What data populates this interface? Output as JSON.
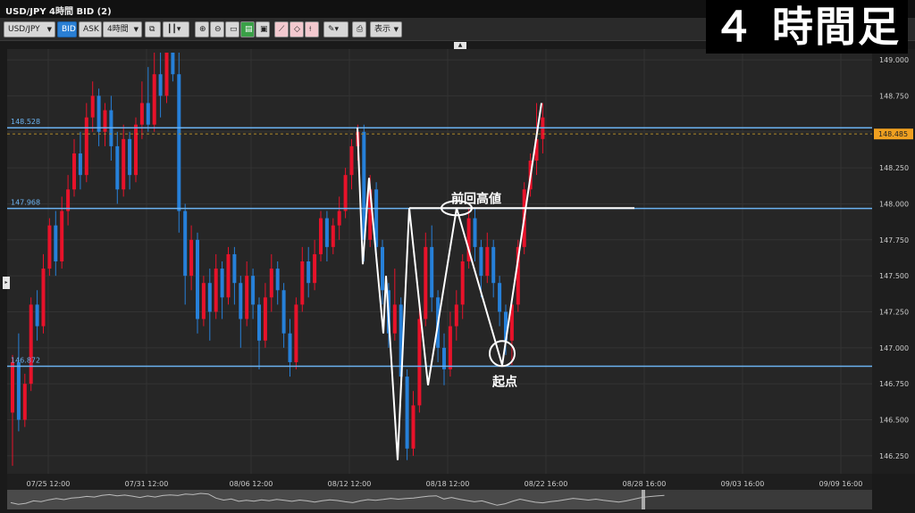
{
  "window": {
    "title": "USD/JPY 4時間 BID (2)"
  },
  "toolbar": {
    "symbol": "USD/JPY",
    "bid_label": "BID",
    "ask_label": "ASK",
    "timeframe": "4時間",
    "display_label": "表示"
  },
  "overlay": {
    "title": "４ 時間足"
  },
  "annotations": {
    "prev_high": "前回高値",
    "start_point": "起点"
  },
  "colors": {
    "up": "#e8122a",
    "down": "#2680d9",
    "hline": "#6bb2f0",
    "background": "#262626"
  },
  "chart_data": {
    "type": "candlestick",
    "y_ticks": [
      "149.000",
      "148.750",
      "148.500",
      "148.250",
      "148.000",
      "147.750",
      "147.500",
      "147.250",
      "147.000",
      "146.750",
      "146.500",
      "146.250"
    ],
    "x_ticks": [
      "07/25 12:00",
      "07/31 12:00",
      "08/06 12:00",
      "08/12 12:00",
      "08/18 12:00",
      "08/22 16:00",
      "08/28 16:00",
      "09/03 16:00",
      "09/09 16:00"
    ],
    "ylim": [
      146.15,
      149.05
    ],
    "current_price": "148.485",
    "current_price_value": 148.485,
    "horizontal_lines": [
      {
        "label": "148.528",
        "value": 148.528
      },
      {
        "label": "147.968",
        "value": 147.968
      },
      {
        "label": "146.872",
        "value": 146.872
      }
    ],
    "zigzag_prices": [
      148.53,
      147.58,
      148.18,
      147.1,
      147.5,
      146.22,
      147.97,
      146.74,
      147.97,
      146.88,
      148.7
    ],
    "prev_high_level": 147.97,
    "start_point_price": 146.96,
    "prev_high_marker_price": 147.97,
    "candles": [
      [
        146.55,
        146.9,
        146.18,
        146.95
      ],
      [
        146.9,
        146.5,
        146.42,
        147.1
      ],
      [
        146.5,
        146.75,
        146.45,
        146.82
      ],
      [
        146.75,
        147.3,
        146.7,
        147.35
      ],
      [
        147.3,
        147.15,
        147.05,
        147.4
      ],
      [
        147.15,
        147.55,
        147.1,
        147.65
      ],
      [
        147.55,
        147.85,
        147.5,
        147.9
      ],
      [
        147.85,
        147.6,
        147.5,
        147.95
      ],
      [
        147.6,
        147.95,
        147.55,
        148.05
      ],
      [
        147.95,
        148.1,
        147.85,
        148.2
      ],
      [
        148.1,
        148.35,
        148.05,
        148.45
      ],
      [
        148.35,
        148.2,
        148.1,
        148.5
      ],
      [
        148.2,
        148.6,
        148.15,
        148.7
      ],
      [
        148.6,
        148.75,
        148.5,
        148.85
      ],
      [
        148.75,
        148.5,
        148.4,
        148.8
      ],
      [
        148.5,
        148.65,
        148.4,
        148.7
      ],
      [
        148.65,
        148.4,
        148.3,
        148.75
      ],
      [
        148.4,
        148.1,
        148.0,
        148.5
      ],
      [
        148.1,
        148.45,
        148.05,
        148.55
      ],
      [
        148.45,
        148.2,
        148.1,
        148.5
      ],
      [
        148.2,
        148.55,
        148.15,
        148.6
      ],
      [
        148.55,
        148.7,
        148.45,
        148.85
      ],
      [
        148.7,
        148.55,
        148.5,
        148.95
      ],
      [
        148.55,
        148.9,
        148.5,
        149.05
      ],
      [
        148.9,
        148.75,
        148.6,
        149.05
      ],
      [
        148.75,
        149.05,
        148.7,
        149.05
      ],
      [
        149.05,
        148.9,
        148.85,
        149.05
      ],
      [
        148.9,
        147.95,
        147.8,
        149.05
      ],
      [
        147.95,
        147.5,
        147.3,
        148.0
      ],
      [
        147.5,
        147.75,
        147.4,
        147.85
      ],
      [
        147.75,
        147.2,
        147.1,
        147.8
      ],
      [
        147.2,
        147.45,
        147.15,
        147.5
      ],
      [
        147.45,
        147.25,
        147.05,
        147.55
      ],
      [
        147.25,
        147.55,
        147.2,
        147.65
      ],
      [
        147.55,
        147.35,
        147.2,
        147.6
      ],
      [
        147.35,
        147.65,
        147.3,
        147.7
      ],
      [
        147.65,
        147.45,
        147.3,
        147.7
      ],
      [
        147.45,
        147.2,
        147.0,
        147.5
      ],
      [
        147.2,
        147.5,
        147.15,
        147.6
      ],
      [
        147.5,
        147.3,
        147.2,
        147.55
      ],
      [
        147.3,
        147.05,
        146.85,
        147.35
      ],
      [
        147.05,
        147.35,
        147.0,
        147.45
      ],
      [
        147.35,
        147.55,
        147.25,
        147.65
      ],
      [
        147.55,
        147.4,
        147.3,
        147.6
      ],
      [
        147.4,
        147.1,
        147.0,
        147.45
      ],
      [
        147.1,
        146.9,
        146.8,
        147.2
      ],
      [
        146.9,
        147.3,
        146.85,
        147.35
      ],
      [
        147.3,
        147.6,
        147.25,
        147.7
      ],
      [
        147.6,
        147.45,
        147.35,
        147.7
      ],
      [
        147.45,
        147.65,
        147.4,
        147.75
      ],
      [
        147.65,
        147.9,
        147.6,
        147.95
      ],
      [
        147.9,
        147.7,
        147.6,
        147.95
      ],
      [
        147.7,
        147.85,
        147.65,
        147.9
      ],
      [
        147.85,
        147.95,
        147.75,
        148.05
      ],
      [
        147.95,
        148.2,
        147.9,
        148.25
      ],
      [
        148.2,
        148.4,
        148.1,
        148.45
      ],
      [
        148.4,
        148.5,
        148.3,
        148.55
      ],
      [
        148.5,
        147.75,
        147.6,
        148.55
      ],
      [
        147.75,
        148.1,
        147.7,
        148.2
      ],
      [
        148.1,
        147.7,
        147.6,
        148.15
      ],
      [
        147.7,
        147.4,
        147.3,
        147.75
      ],
      [
        147.4,
        147.1,
        147.0,
        147.45
      ],
      [
        147.1,
        147.3,
        147.05,
        147.55
      ],
      [
        147.3,
        146.8,
        146.7,
        147.35
      ],
      [
        146.8,
        146.3,
        146.22,
        146.85
      ],
      [
        146.3,
        146.6,
        146.25,
        146.7
      ],
      [
        146.6,
        147.2,
        146.55,
        147.3
      ],
      [
        147.2,
        147.7,
        147.15,
        147.8
      ],
      [
        147.7,
        147.35,
        147.25,
        147.85
      ],
      [
        147.35,
        147.0,
        146.9,
        147.4
      ],
      [
        147.0,
        146.85,
        146.74,
        147.1
      ],
      [
        146.85,
        147.15,
        146.8,
        147.25
      ],
      [
        147.15,
        147.3,
        147.05,
        147.4
      ],
      [
        147.3,
        147.6,
        147.2,
        147.65
      ],
      [
        147.6,
        147.9,
        147.55,
        147.97
      ],
      [
        147.9,
        147.7,
        147.6,
        147.97
      ],
      [
        147.7,
        147.5,
        147.35,
        147.75
      ],
      [
        147.5,
        147.7,
        147.45,
        147.8
      ],
      [
        147.7,
        147.45,
        147.35,
        147.75
      ],
      [
        147.45,
        147.25,
        147.15,
        147.5
      ],
      [
        147.25,
        147.05,
        146.95,
        147.3
      ],
      [
        147.05,
        147.3,
        146.88,
        147.35
      ],
      [
        147.3,
        147.7,
        147.25,
        147.75
      ],
      [
        147.7,
        148.1,
        147.65,
        148.15
      ],
      [
        148.1,
        148.3,
        148.05,
        148.35
      ],
      [
        148.3,
        148.45,
        148.2,
        148.7
      ],
      [
        148.45,
        148.6,
        148.35,
        148.7
      ]
    ]
  }
}
